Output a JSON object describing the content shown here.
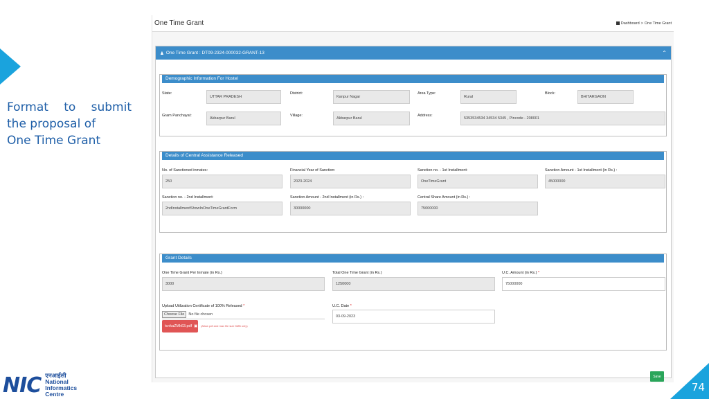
{
  "caption": {
    "line1": [
      "Format",
      "to",
      "submit"
    ],
    "line2": "the proposal of",
    "line3": "One Time Grant"
  },
  "logo": {
    "mark": "NIC",
    "hindi": "एनआईसी",
    "line1": "National",
    "line2": "Informatics",
    "line3": "Centre"
  },
  "page_number": "74",
  "app": {
    "page_title": "One Time Grant",
    "breadcrumb": {
      "home": "Dashboard",
      "separator": ">",
      "current": "One Time Grant"
    },
    "panel_title": "One Time Grant : DT09-2324-000032-GRANT-13",
    "demographic": {
      "title": "Demographic Information For Hostel",
      "state_label": "State:",
      "state_value": "UTTAR PRADESH",
      "district_label": "District:",
      "district_value": "Kanpur Nagar",
      "area_label": "Area Type:",
      "area_value": "Rural",
      "block_label": "Block:",
      "block_value": "BHITARGAON",
      "gp_label": "Gram Panchayat:",
      "gp_value": "Akbarpur Barul",
      "village_label": "Village:",
      "village_value": "Akbarpur Barul",
      "address_label": "Address:",
      "address_value": "5353534534 34534 5345 , Pincode - 208001"
    },
    "central": {
      "title": "Details of Central Assistance Released",
      "inmates_label": "No. of Sanctioned inmates:",
      "inmates_value": "250",
      "fy_label": "Financial Year of Sanction:",
      "fy_value": "2023-2024",
      "sanc1_label": "Sanction no. - 1st Installment:",
      "sanc1_value": "OneTimeGrant",
      "amt1_label": "Sanction Amount - 1st Installment (in Rs.) :",
      "amt1_value": "45000000",
      "sanc2_label": "Sanction no. - 2nd Installment:",
      "sanc2_value": "2ndInstallmentShowInOneTimeGrantForm",
      "amt2_label": "Sanction Amount - 2nd Installment (in Rs.) :",
      "amt2_value": "30000000",
      "share_label": "Central Share Amount (in Rs.) :",
      "share_value": "75000000"
    },
    "grant": {
      "title": "Grant Details",
      "per_inmate_label": "One Time Grant Per Inmate (in Rs.)",
      "per_inmate_value": "3000",
      "total_label": "Total One Time Grant (in Rs.)",
      "total_value": "1250000",
      "uc_amount_label": "U.C. Amount (in Rs.)",
      "uc_amount_value": "75000000",
      "upload_label": "Upload Utilization Certificate of 100% Released",
      "choose_label": "Choose File",
      "no_file": "No file chosen",
      "file_name": "tcnkaZMk63.pdf",
      "note": "(Allow pdf and max file size 5MB only)",
      "uc_date_label": "U.C. Date",
      "uc_date_value": "03-09-2023",
      "required_mark": "*"
    },
    "save_label": "Save"
  },
  "colors": {
    "accent": "#3c8dca",
    "brand": "#1aa3dd",
    "danger": "#e05555",
    "save": "#2aa55a"
  }
}
